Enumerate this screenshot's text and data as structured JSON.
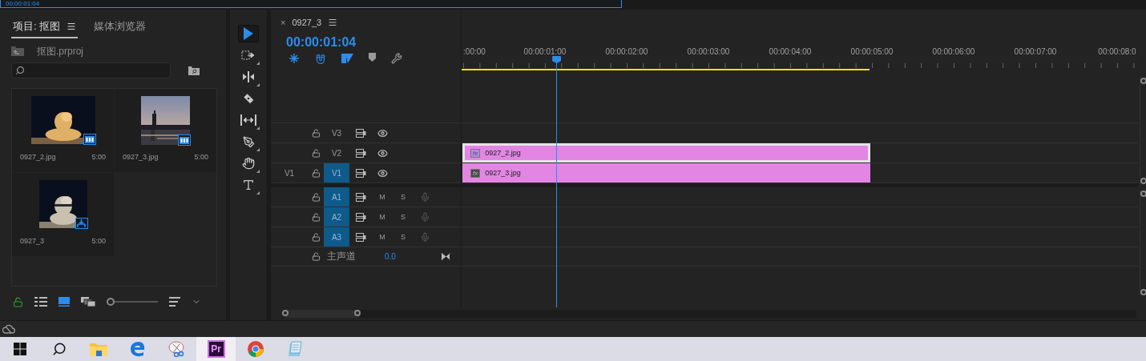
{
  "top_strip": {
    "timecode": "00:00:01:04"
  },
  "project": {
    "tabs": [
      {
        "label": "项目: 抠图",
        "selected": true
      },
      {
        "label": "媒体浏览器",
        "selected": false
      }
    ],
    "path": "抠图.prproj",
    "items": [
      {
        "name": "0927_2.jpg",
        "duration": "5:00",
        "kind": "clip"
      },
      {
        "name": "0927_3.jpg",
        "duration": "5:00",
        "kind": "clip"
      },
      {
        "name": "0927_3",
        "duration": "5:00",
        "kind": "sequence"
      }
    ],
    "views": [
      {
        "kind": "list",
        "selected": false
      },
      {
        "kind": "icon",
        "selected": true
      },
      {
        "kind": "freeform",
        "selected": false
      }
    ],
    "zoom": {
      "level": 0
    }
  },
  "tools": [
    {
      "kind": "select",
      "selected": true
    },
    {
      "kind": "track-select",
      "selected": false
    },
    {
      "kind": "ripple",
      "selected": false
    },
    {
      "kind": "razor",
      "selected": false
    },
    {
      "kind": "slip",
      "selected": false
    },
    {
      "kind": "pen",
      "selected": false
    },
    {
      "kind": "hand",
      "selected": false
    },
    {
      "kind": "type",
      "selected": false
    }
  ],
  "timeline": {
    "close": "×",
    "tab": "0927_3",
    "timecode": "00:00:01:04",
    "toggles": [
      {
        "kind": "nest",
        "on": true
      },
      {
        "kind": "snap",
        "on": true
      },
      {
        "kind": "linked",
        "on": true
      },
      {
        "kind": "marker",
        "on": false
      },
      {
        "kind": "settings",
        "on": false
      }
    ],
    "ruler": [
      ":00:00",
      "00:00:01:00",
      "00:00:02:00",
      "00:00:03:00",
      "00:00:04:00",
      "00:00:05:00",
      "00:00:06:00",
      "00:00:07:00",
      "00:00:08:0"
    ],
    "playhead": {
      "level": 0.14
    },
    "work_area": {
      "level": 0.603
    },
    "video_tracks": [
      {
        "name": "V3",
        "targeted": false
      },
      {
        "name": "V2",
        "targeted": false,
        "clip": {
          "fx": "fx",
          "name": "0927_2.jpg",
          "selected": true
        }
      },
      {
        "name": "V1",
        "source": "V1",
        "targeted": true,
        "clip": {
          "fx": "fx",
          "name": "0927_3.jpg",
          "selected": false
        }
      }
    ],
    "audio_tracks": [
      {
        "name": "A1",
        "targeted": true,
        "mute": "M",
        "solo": "S"
      },
      {
        "name": "A2",
        "targeted": true,
        "mute": "M",
        "solo": "S"
      },
      {
        "name": "A3",
        "targeted": true,
        "mute": "M",
        "solo": "S"
      }
    ],
    "master": {
      "label": "主声道",
      "value": "0.0"
    }
  },
  "taskbar": {
    "apps": [
      {
        "kind": "start",
        "selected": false
      },
      {
        "kind": "search",
        "selected": false
      },
      {
        "kind": "explorer",
        "selected": false
      },
      {
        "kind": "edge",
        "selected": false
      },
      {
        "kind": "snip",
        "selected": false
      },
      {
        "kind": "premiere",
        "label": "Pr",
        "selected": true
      },
      {
        "kind": "chrome",
        "selected": false
      },
      {
        "kind": "notepad",
        "selected": false
      }
    ]
  }
}
